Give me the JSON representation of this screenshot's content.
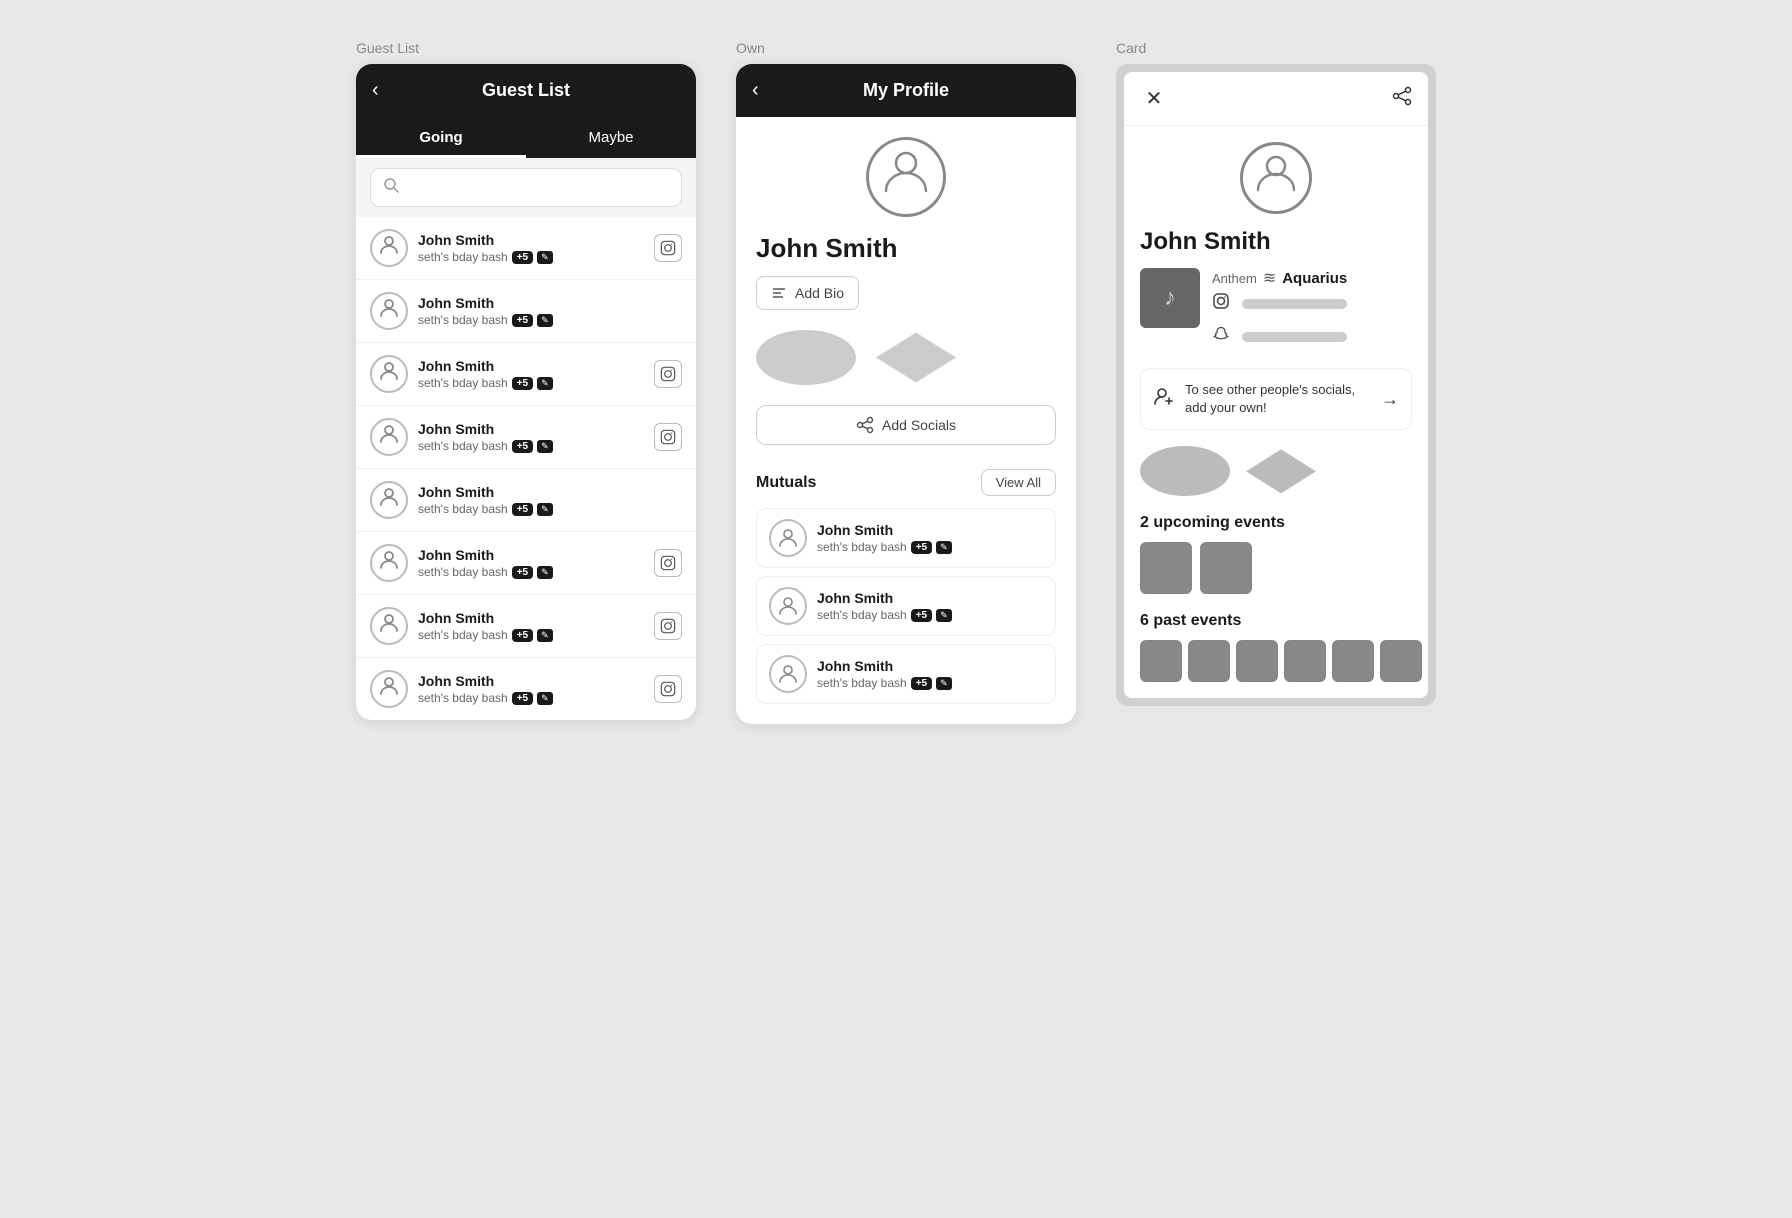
{
  "guestList": {
    "columnLabel": "Guest List",
    "header": {
      "backIcon": "‹",
      "title": "Guest List"
    },
    "tabs": [
      {
        "id": "going",
        "label": "Going",
        "active": true
      },
      {
        "id": "maybe",
        "label": "Maybe",
        "active": false
      }
    ],
    "searchPlaceholder": "",
    "rows": [
      {
        "name": "John Smith",
        "sub": "seth's bday bash",
        "badge": "+5",
        "hasIG": true
      },
      {
        "name": "John Smith",
        "sub": "seth's bday bash",
        "badge": "+5",
        "hasIG": false
      },
      {
        "name": "John Smith",
        "sub": "seth's bday bash",
        "badge": "+5",
        "hasIG": true
      },
      {
        "name": "John Smith",
        "sub": "seth's bday bash",
        "badge": "+5",
        "hasIG": true
      },
      {
        "name": "John Smith",
        "sub": "seth's bday bash",
        "badge": "+5",
        "hasIG": false
      },
      {
        "name": "John Smith",
        "sub": "seth's bday bash",
        "badge": "+5",
        "hasIG": true
      },
      {
        "name": "John Smith",
        "sub": "seth's bday bash",
        "badge": "+5",
        "hasIG": true
      },
      {
        "name": "John Smith",
        "sub": "seth's bday bash",
        "badge": "+5",
        "hasIG": true
      }
    ]
  },
  "ownProfile": {
    "columnLabel": "Own",
    "header": {
      "backIcon": "‹",
      "title": "My Profile"
    },
    "name": "John Smith",
    "addBioLabel": "Add Bio",
    "addSocialsLabel": "Add Socials",
    "mutuals": {
      "label": "Mutuals",
      "viewAllLabel": "View All",
      "rows": [
        {
          "name": "John Smith",
          "sub": "seth's bday bash",
          "badge": "+5"
        },
        {
          "name": "John Smith",
          "sub": "seth's bday bash",
          "badge": "+5"
        },
        {
          "name": "John Smith",
          "sub": "seth's bday bash",
          "badge": "+5"
        }
      ]
    }
  },
  "card": {
    "columnLabel": "Card",
    "closeIcon": "✕",
    "shareIcon": "⎙",
    "name": "John Smith",
    "anthem": {
      "label": "Anthem",
      "squiggleIcon": "≋",
      "name": "Aquarius",
      "musicNote": "♪"
    },
    "socials": [
      {
        "icon": "ig",
        "unicode": "📷"
      },
      {
        "icon": "snap",
        "unicode": "👻"
      }
    ],
    "prompt": {
      "icon": "👤",
      "text": "To see other people's socials, add your own!",
      "arrowIcon": "→"
    },
    "upcomingLabel": "2 upcoming events",
    "upcomingCount": 2,
    "pastLabel": "6 past events",
    "pastCount": 6
  }
}
